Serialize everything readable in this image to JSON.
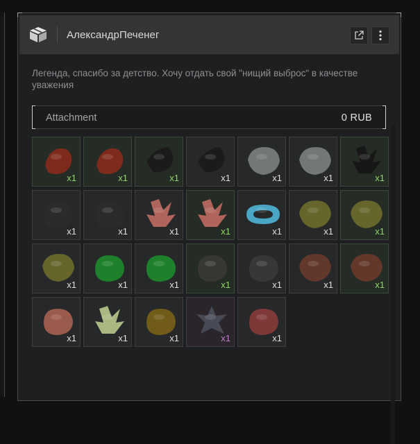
{
  "window": {
    "title": "АлександрПеченег",
    "message": "Легенда, спасибо за детство. Хочу отдать свой \"нищий выброс\" в качестве уважения"
  },
  "attachment": {
    "label": "Attachment",
    "value": "0 RUB"
  },
  "colors": {
    "rarity_green": "#8fd86a",
    "rarity_purple": "#c77dd1",
    "rarity_common": "#e0e0e0"
  },
  "items": [
    {
      "name": "artifact-red-claw",
      "qty": "x1",
      "rarity": "green",
      "color": "#8a2b1c"
    },
    {
      "name": "artifact-red-claw",
      "qty": "x1",
      "rarity": "green",
      "color": "#8a2b1c"
    },
    {
      "name": "artifact-black-shard",
      "qty": "x1",
      "rarity": "green",
      "color": "#1a1a1a"
    },
    {
      "name": "artifact-black-shard",
      "qty": "x1",
      "rarity": "common",
      "color": "#1a1a1a"
    },
    {
      "name": "artifact-grey-shell",
      "qty": "x1",
      "rarity": "common",
      "color": "#7b7f80"
    },
    {
      "name": "artifact-grey-shell",
      "qty": "x1",
      "rarity": "common",
      "color": "#7b7f80"
    },
    {
      "name": "artifact-dark-crystal",
      "qty": "x1",
      "rarity": "green",
      "color": "#151515"
    },
    {
      "name": "artifact-dark-cluster",
      "qty": "x1",
      "rarity": "common",
      "color": "#2b2b2b"
    },
    {
      "name": "artifact-dark-cluster",
      "qty": "x1",
      "rarity": "common",
      "color": "#2b2b2b"
    },
    {
      "name": "artifact-pink-crystal",
      "qty": "x1",
      "rarity": "common",
      "color": "#c06a62"
    },
    {
      "name": "artifact-pink-crystal",
      "qty": "x1",
      "rarity": "green",
      "color": "#c06a62"
    },
    {
      "name": "artifact-blue-ring",
      "qty": "x1",
      "rarity": "common",
      "color": "#4fb4d6"
    },
    {
      "name": "artifact-olive-shell",
      "qty": "x1",
      "rarity": "common",
      "color": "#6e6b2c"
    },
    {
      "name": "artifact-olive-shell",
      "qty": "x1",
      "rarity": "green",
      "color": "#6e6b2c"
    },
    {
      "name": "artifact-olive-shell",
      "qty": "x1",
      "rarity": "common",
      "color": "#6e6b2c"
    },
    {
      "name": "artifact-green-gem",
      "qty": "x1",
      "rarity": "common",
      "color": "#1e8a2a"
    },
    {
      "name": "artifact-green-gem",
      "qty": "x1",
      "rarity": "common",
      "color": "#1e8a2a"
    },
    {
      "name": "artifact-dark-lump",
      "qty": "x1",
      "rarity": "green",
      "color": "#3a3a36"
    },
    {
      "name": "artifact-dark-lump",
      "qty": "x1",
      "rarity": "common",
      "color": "#3a3a36"
    },
    {
      "name": "artifact-brown-husk",
      "qty": "x1",
      "rarity": "common",
      "color": "#6a3a2c"
    },
    {
      "name": "artifact-brown-husk",
      "qty": "x1",
      "rarity": "green",
      "color": "#6a3a2c"
    },
    {
      "name": "artifact-pink-bulb",
      "qty": "x1",
      "rarity": "common",
      "color": "#a86050"
    },
    {
      "name": "artifact-pale-crystal",
      "qty": "x1",
      "rarity": "common",
      "color": "#b8c68a"
    },
    {
      "name": "artifact-gold-nugget",
      "qty": "x1",
      "rarity": "common",
      "color": "#7a6016"
    },
    {
      "name": "artifact-steel-star",
      "qty": "x1",
      "rarity": "purple",
      "color": "#4a4e5a"
    },
    {
      "name": "artifact-red-blossom",
      "qty": "x1",
      "rarity": "common",
      "color": "#8a3a3a"
    }
  ]
}
